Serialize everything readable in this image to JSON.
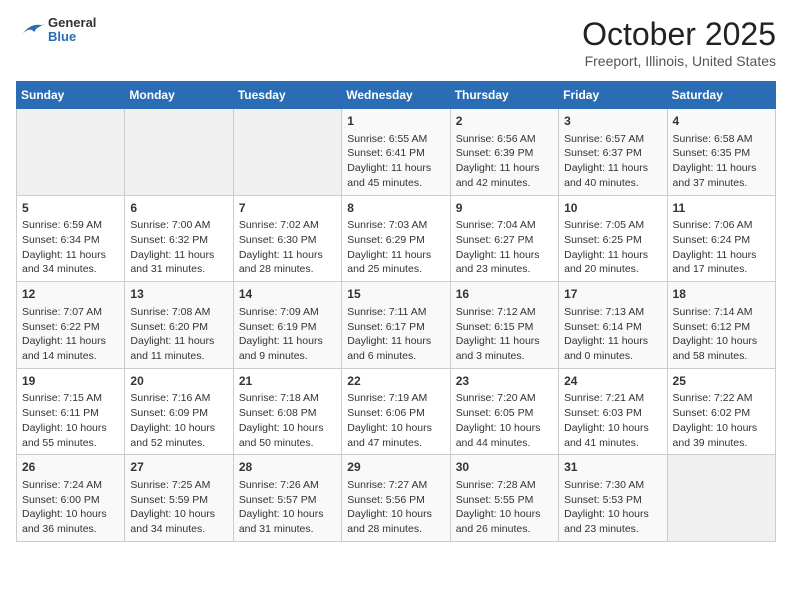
{
  "logo": {
    "general": "General",
    "blue": "Blue"
  },
  "title": "October 2025",
  "subtitle": "Freeport, Illinois, United States",
  "days_of_week": [
    "Sunday",
    "Monday",
    "Tuesday",
    "Wednesday",
    "Thursday",
    "Friday",
    "Saturday"
  ],
  "weeks": [
    [
      {
        "day": "",
        "info": ""
      },
      {
        "day": "",
        "info": ""
      },
      {
        "day": "",
        "info": ""
      },
      {
        "day": "1",
        "info": "Sunrise: 6:55 AM\nSunset: 6:41 PM\nDaylight: 11 hours and 45 minutes."
      },
      {
        "day": "2",
        "info": "Sunrise: 6:56 AM\nSunset: 6:39 PM\nDaylight: 11 hours and 42 minutes."
      },
      {
        "day": "3",
        "info": "Sunrise: 6:57 AM\nSunset: 6:37 PM\nDaylight: 11 hours and 40 minutes."
      },
      {
        "day": "4",
        "info": "Sunrise: 6:58 AM\nSunset: 6:35 PM\nDaylight: 11 hours and 37 minutes."
      }
    ],
    [
      {
        "day": "5",
        "info": "Sunrise: 6:59 AM\nSunset: 6:34 PM\nDaylight: 11 hours and 34 minutes."
      },
      {
        "day": "6",
        "info": "Sunrise: 7:00 AM\nSunset: 6:32 PM\nDaylight: 11 hours and 31 minutes."
      },
      {
        "day": "7",
        "info": "Sunrise: 7:02 AM\nSunset: 6:30 PM\nDaylight: 11 hours and 28 minutes."
      },
      {
        "day": "8",
        "info": "Sunrise: 7:03 AM\nSunset: 6:29 PM\nDaylight: 11 hours and 25 minutes."
      },
      {
        "day": "9",
        "info": "Sunrise: 7:04 AM\nSunset: 6:27 PM\nDaylight: 11 hours and 23 minutes."
      },
      {
        "day": "10",
        "info": "Sunrise: 7:05 AM\nSunset: 6:25 PM\nDaylight: 11 hours and 20 minutes."
      },
      {
        "day": "11",
        "info": "Sunrise: 7:06 AM\nSunset: 6:24 PM\nDaylight: 11 hours and 17 minutes."
      }
    ],
    [
      {
        "day": "12",
        "info": "Sunrise: 7:07 AM\nSunset: 6:22 PM\nDaylight: 11 hours and 14 minutes."
      },
      {
        "day": "13",
        "info": "Sunrise: 7:08 AM\nSunset: 6:20 PM\nDaylight: 11 hours and 11 minutes."
      },
      {
        "day": "14",
        "info": "Sunrise: 7:09 AM\nSunset: 6:19 PM\nDaylight: 11 hours and 9 minutes."
      },
      {
        "day": "15",
        "info": "Sunrise: 7:11 AM\nSunset: 6:17 PM\nDaylight: 11 hours and 6 minutes."
      },
      {
        "day": "16",
        "info": "Sunrise: 7:12 AM\nSunset: 6:15 PM\nDaylight: 11 hours and 3 minutes."
      },
      {
        "day": "17",
        "info": "Sunrise: 7:13 AM\nSunset: 6:14 PM\nDaylight: 11 hours and 0 minutes."
      },
      {
        "day": "18",
        "info": "Sunrise: 7:14 AM\nSunset: 6:12 PM\nDaylight: 10 hours and 58 minutes."
      }
    ],
    [
      {
        "day": "19",
        "info": "Sunrise: 7:15 AM\nSunset: 6:11 PM\nDaylight: 10 hours and 55 minutes."
      },
      {
        "day": "20",
        "info": "Sunrise: 7:16 AM\nSunset: 6:09 PM\nDaylight: 10 hours and 52 minutes."
      },
      {
        "day": "21",
        "info": "Sunrise: 7:18 AM\nSunset: 6:08 PM\nDaylight: 10 hours and 50 minutes."
      },
      {
        "day": "22",
        "info": "Sunrise: 7:19 AM\nSunset: 6:06 PM\nDaylight: 10 hours and 47 minutes."
      },
      {
        "day": "23",
        "info": "Sunrise: 7:20 AM\nSunset: 6:05 PM\nDaylight: 10 hours and 44 minutes."
      },
      {
        "day": "24",
        "info": "Sunrise: 7:21 AM\nSunset: 6:03 PM\nDaylight: 10 hours and 41 minutes."
      },
      {
        "day": "25",
        "info": "Sunrise: 7:22 AM\nSunset: 6:02 PM\nDaylight: 10 hours and 39 minutes."
      }
    ],
    [
      {
        "day": "26",
        "info": "Sunrise: 7:24 AM\nSunset: 6:00 PM\nDaylight: 10 hours and 36 minutes."
      },
      {
        "day": "27",
        "info": "Sunrise: 7:25 AM\nSunset: 5:59 PM\nDaylight: 10 hours and 34 minutes."
      },
      {
        "day": "28",
        "info": "Sunrise: 7:26 AM\nSunset: 5:57 PM\nDaylight: 10 hours and 31 minutes."
      },
      {
        "day": "29",
        "info": "Sunrise: 7:27 AM\nSunset: 5:56 PM\nDaylight: 10 hours and 28 minutes."
      },
      {
        "day": "30",
        "info": "Sunrise: 7:28 AM\nSunset: 5:55 PM\nDaylight: 10 hours and 26 minutes."
      },
      {
        "day": "31",
        "info": "Sunrise: 7:30 AM\nSunset: 5:53 PM\nDaylight: 10 hours and 23 minutes."
      },
      {
        "day": "",
        "info": ""
      }
    ]
  ]
}
